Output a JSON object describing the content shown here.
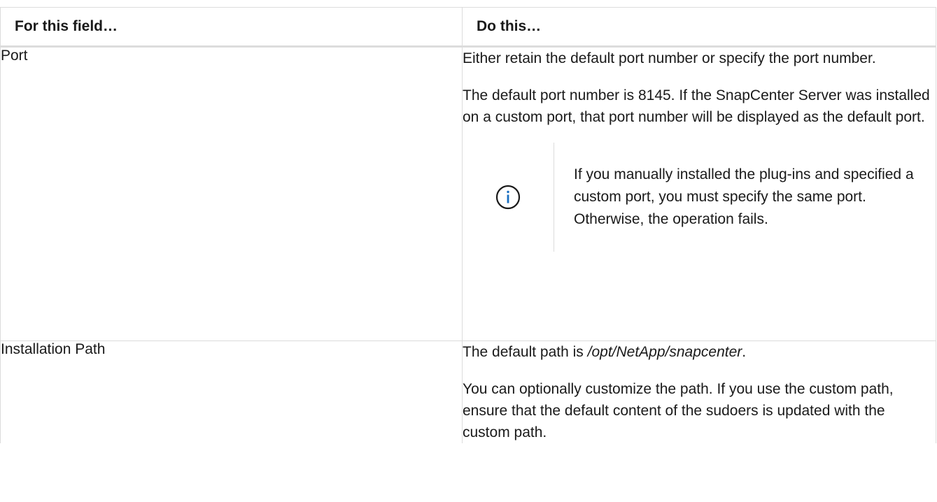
{
  "table": {
    "headers": {
      "field": "For this field…",
      "action": "Do this…"
    },
    "rows": [
      {
        "field": "Port",
        "paragraphs": [
          "Either retain the default port number or specify the port number.",
          "The default port number is 8145. If the SnapCenter Server was installed on a custom port, that port number will be displayed as the default port."
        ],
        "note": {
          "icon": "info-icon",
          "text": "If you manually installed the plug-ins and specified a custom port, you must specify the same port. Otherwise, the operation fails."
        }
      },
      {
        "field": "Installation Path",
        "default_path_prefix": "The default path is ",
        "default_path_value": "/opt/NetApp/snapcenter",
        "default_path_suffix": ".",
        "paragraphs": [
          "You can optionally customize the path. If you use the custom path, ensure that the default content of the sudoers is updated with the custom path."
        ]
      }
    ]
  },
  "colors": {
    "border": "#dcdcdc",
    "info_icon": "#1a6fc1",
    "text": "#1a1a1a"
  }
}
